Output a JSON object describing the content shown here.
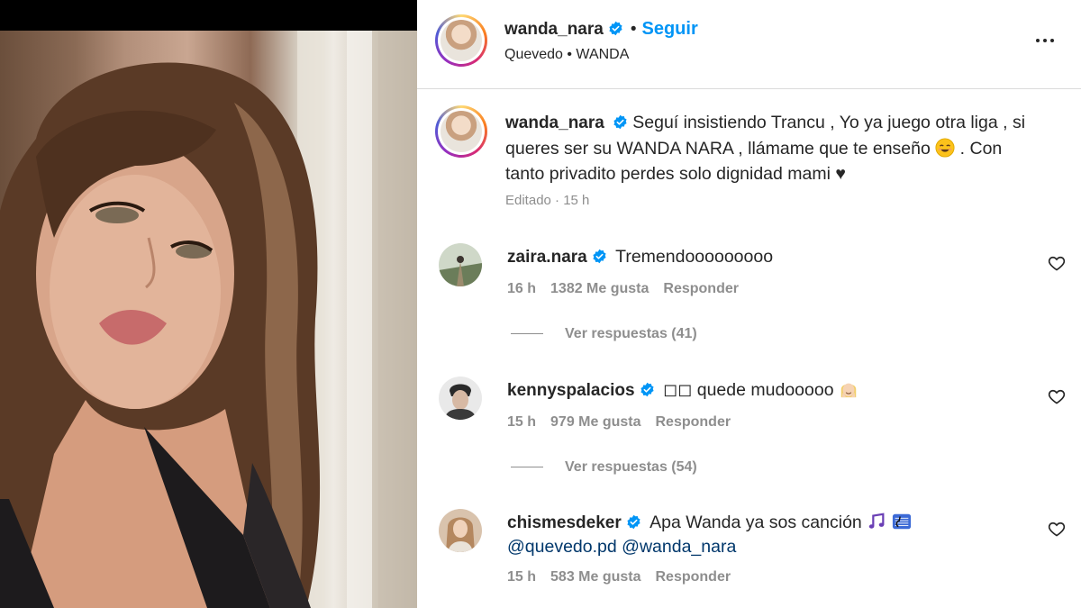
{
  "post": {
    "username": "wanda_nara",
    "separator": "•",
    "follow_label": "Seguir",
    "location": "Quevedo • WANDA",
    "caption": {
      "username": "wanda_nara",
      "text_part1": "Seguí insistiendo Trancu , Yo ya juego otra liga , si queres ser su WANDA NARA , llámame que te enseño",
      "text_part2": ". Con tanto privadito perdes solo dignidad mami ♥",
      "meta": "Editado · 15 h"
    }
  },
  "comments": [
    {
      "username": "zaira.nara",
      "text": "Tremendooooooooo",
      "time": "16 h",
      "likes": "1382 Me gusta",
      "reply_label": "Responder",
      "view_replies": "Ver respuestas (41)"
    },
    {
      "username": "kennyspalacios",
      "text": "◻◻ quede mudooooo",
      "time": "15 h",
      "likes": "979 Me gusta",
      "reply_label": "Responder",
      "view_replies": "Ver respuestas (54)"
    },
    {
      "username": "chismesdeker",
      "text": "Apa Wanda ya sos canción",
      "mention1": "@quevedo.pd",
      "mention2": "@wanda_nara",
      "time": "15 h",
      "likes": "583 Me gusta",
      "reply_label": "Responder"
    }
  ],
  "colors": {
    "accent": "#0095f6",
    "muted": "#8e8e8e",
    "text": "#262626",
    "verified": "#0095f6"
  }
}
